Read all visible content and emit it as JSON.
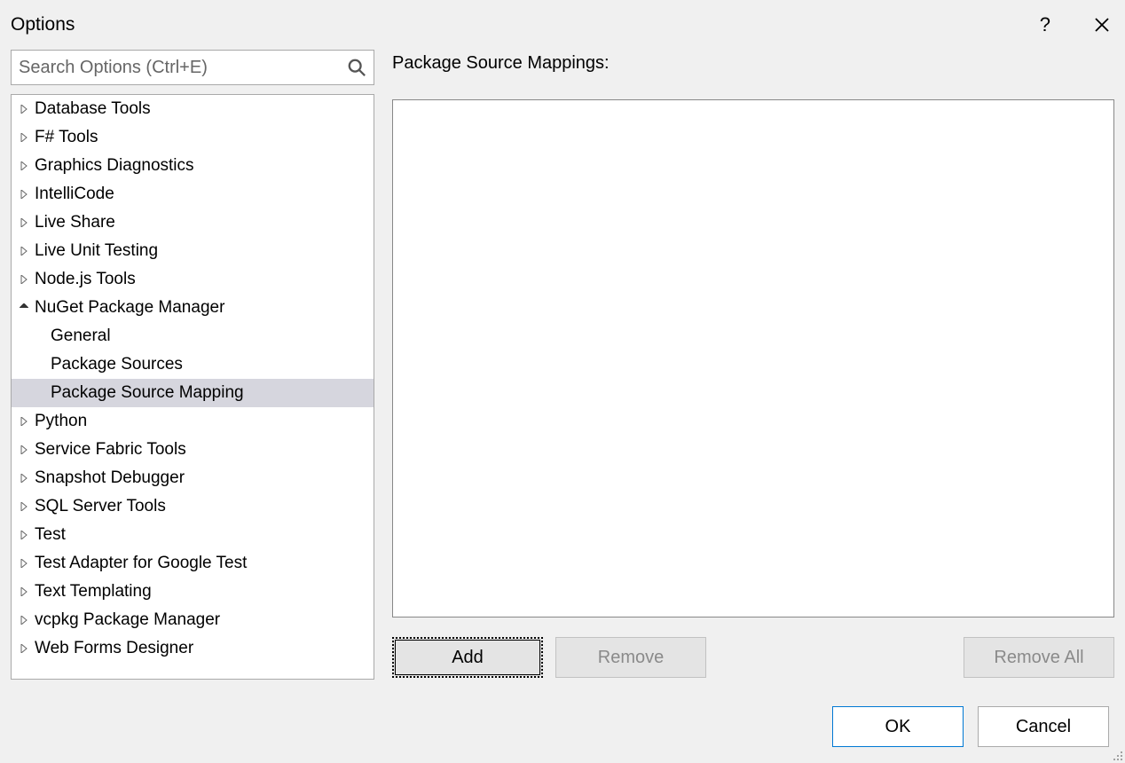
{
  "title": "Options",
  "search": {
    "placeholder": "Search Options (Ctrl+E)"
  },
  "tree": {
    "items": [
      {
        "label": "Database Tools",
        "expanded": false,
        "children": []
      },
      {
        "label": "F# Tools",
        "expanded": false,
        "children": []
      },
      {
        "label": "Graphics Diagnostics",
        "expanded": false,
        "children": []
      },
      {
        "label": "IntelliCode",
        "expanded": false,
        "children": []
      },
      {
        "label": "Live Share",
        "expanded": false,
        "children": []
      },
      {
        "label": "Live Unit Testing",
        "expanded": false,
        "children": []
      },
      {
        "label": "Node.js Tools",
        "expanded": false,
        "children": []
      },
      {
        "label": "NuGet Package Manager",
        "expanded": true,
        "children": [
          {
            "label": "General",
            "selected": false
          },
          {
            "label": "Package Sources",
            "selected": false
          },
          {
            "label": "Package Source Mapping",
            "selected": true
          }
        ]
      },
      {
        "label": "Python",
        "expanded": false,
        "children": []
      },
      {
        "label": "Service Fabric Tools",
        "expanded": false,
        "children": []
      },
      {
        "label": "Snapshot Debugger",
        "expanded": false,
        "children": []
      },
      {
        "label": "SQL Server Tools",
        "expanded": false,
        "children": []
      },
      {
        "label": "Test",
        "expanded": false,
        "children": []
      },
      {
        "label": "Test Adapter for Google Test",
        "expanded": false,
        "children": []
      },
      {
        "label": "Text Templating",
        "expanded": false,
        "children": []
      },
      {
        "label": "vcpkg Package Manager",
        "expanded": false,
        "children": []
      },
      {
        "label": "Web Forms Designer",
        "expanded": false,
        "children": []
      }
    ]
  },
  "right": {
    "section_title": "Package Source Mappings:",
    "buttons": {
      "add": "Add",
      "remove": "Remove",
      "remove_all": "Remove All"
    }
  },
  "footer": {
    "ok": "OK",
    "cancel": "Cancel"
  }
}
